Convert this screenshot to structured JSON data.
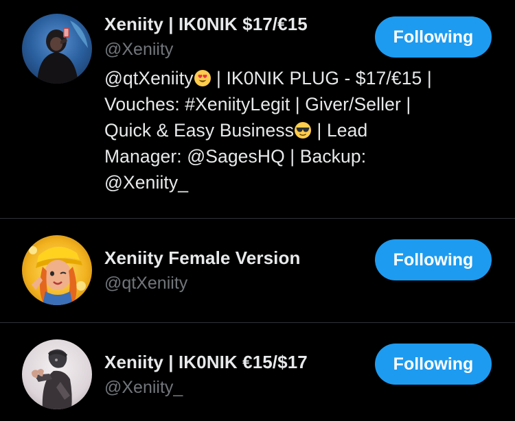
{
  "accounts": [
    {
      "display_name": "Xeniity | IK0NIK $17/€15",
      "handle": "@Xeniity",
      "bio_lines": [
        "@qtXeniity",
        " | IK0NIK PLUG - $17/€15 |",
        "Vouches: #XeniityLegit | Giver/Seller |",
        "Quick & Easy Business",
        " | Lead",
        "Manager: @SagesHQ | Backup:",
        "@Xeniity_"
      ],
      "bio_emojis": [
        "heart-eyes-emoji",
        "sunglasses-emoji"
      ],
      "button_label": "Following",
      "avatar_icon": "avatar-hooded-selfie"
    },
    {
      "display_name": "Xeniity Female Version",
      "handle": "@qtXeniity",
      "button_label": "Following",
      "avatar_icon": "avatar-character-yellow-cap"
    },
    {
      "display_name": "Xeniity | IK0NIK €15/$17",
      "handle": "@Xeniity_",
      "button_label": "Following",
      "avatar_icon": "avatar-dark-figure"
    }
  ],
  "colors": {
    "background": "#000000",
    "primary_text": "#e7e9ea",
    "secondary_text": "#71767b",
    "accent": "#1d9bf0",
    "divider": "#2f3336"
  }
}
